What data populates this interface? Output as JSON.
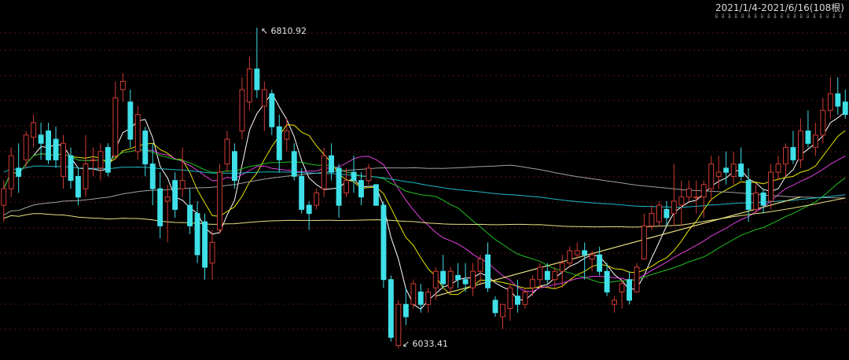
{
  "header": {
    "range_label": "2021/1/4-2021/6/16(108根)",
    "nav_arrows": "⇓⇓⇓⇓⇓⇓⇓⇓⇓⇓⇓⇓⇓⇓⇓⇓⇓⇓⇓⇓"
  },
  "annotations": {
    "high_label": "6810.92",
    "low_label": "6033.41"
  },
  "colors": {
    "background": "#000000",
    "up": "#d13b35",
    "down": "#3fe0e8",
    "grid": "#5a1414",
    "ma5": "#ffffff",
    "ma10": "#e6e600",
    "ma20": "#e040e0",
    "ma30": "#20c020",
    "ma60": "#a0a0a0",
    "ma120": "#20b8c8",
    "ma250": "#e8e080",
    "trendline": "#e8e080"
  },
  "chart_data": {
    "type": "candlestick",
    "title": "",
    "period_label": "2021/1/4-2021/6/16(108根)",
    "bar_count": 108,
    "high_annotation": 6810.92,
    "low_annotation": 6033.41,
    "ylim": [
      6030,
      6820
    ],
    "grid": true,
    "candles": [
      [
        6380,
        6440,
        6340,
        6420
      ],
      [
        6420,
        6520,
        6400,
        6500
      ],
      [
        6470,
        6530,
        6410,
        6450
      ],
      [
        6490,
        6560,
        6470,
        6550
      ],
      [
        6545,
        6600,
        6520,
        6580
      ],
      [
        6550,
        6580,
        6490,
        6530
      ],
      [
        6560,
        6580,
        6480,
        6490
      ],
      [
        6540,
        6570,
        6470,
        6490
      ],
      [
        6450,
        6550,
        6420,
        6530
      ],
      [
        6500,
        6520,
        6420,
        6440
      ],
      [
        6450,
        6470,
        6380,
        6400
      ],
      [
        6420,
        6550,
        6400,
        6480
      ],
      [
        6490,
        6520,
        6450,
        6490
      ],
      [
        6470,
        6530,
        6440,
        6510
      ],
      [
        6520,
        6530,
        6450,
        6460
      ],
      [
        6500,
        6680,
        6490,
        6640
      ],
      [
        6660,
        6700,
        6630,
        6680
      ],
      [
        6630,
        6660,
        6520,
        6540
      ],
      [
        6510,
        6620,
        6490,
        6600
      ],
      [
        6560,
        6570,
        6450,
        6480
      ],
      [
        6480,
        6530,
        6380,
        6420
      ],
      [
        6420,
        6460,
        6300,
        6330
      ],
      [
        6390,
        6430,
        6290,
        6400
      ],
      [
        6440,
        6460,
        6350,
        6370
      ],
      [
        6420,
        6520,
        6400,
        6440
      ],
      [
        6380,
        6420,
        6310,
        6330
      ],
      [
        6360,
        6390,
        6240,
        6260
      ],
      [
        6340,
        6360,
        6200,
        6230
      ],
      [
        6240,
        6320,
        6200,
        6290
      ],
      [
        6320,
        6480,
        6310,
        6460
      ],
      [
        6480,
        6560,
        6460,
        6540
      ],
      [
        6510,
        6530,
        6420,
        6440
      ],
      [
        6560,
        6690,
        6540,
        6660
      ],
      [
        6630,
        6740,
        6610,
        6710
      ],
      [
        6710,
        6810,
        6640,
        6660
      ],
      [
        6620,
        6680,
        6560,
        6660
      ],
      [
        6650,
        6660,
        6550,
        6570
      ],
      [
        6570,
        6600,
        6460,
        6490
      ],
      [
        6540,
        6590,
        6510,
        6560
      ],
      [
        6510,
        6530,
        6440,
        6450
      ],
      [
        6450,
        6470,
        6360,
        6370
      ],
      [
        6380,
        6390,
        6320,
        6360
      ],
      [
        6380,
        6420,
        6370,
        6410
      ],
      [
        6420,
        6520,
        6400,
        6500
      ],
      [
        6500,
        6530,
        6440,
        6460
      ],
      [
        6470,
        6480,
        6350,
        6380
      ],
      [
        6410,
        6470,
        6400,
        6440
      ],
      [
        6460,
        6500,
        6410,
        6440
      ],
      [
        6440,
        6460,
        6380,
        6400
      ],
      [
        6440,
        6480,
        6430,
        6470
      ],
      [
        6430,
        6430,
        6380,
        6380
      ],
      [
        6380,
        6390,
        6180,
        6200
      ],
      [
        6200,
        6210,
        6050,
        6060
      ],
      [
        6040,
        6150,
        6033,
        6140
      ],
      [
        6140,
        6180,
        6090,
        6110
      ],
      [
        6140,
        6200,
        6130,
        6190
      ],
      [
        6170,
        6190,
        6120,
        6140
      ],
      [
        6140,
        6180,
        6120,
        6170
      ],
      [
        6180,
        6230,
        6150,
        6220
      ],
      [
        6220,
        6260,
        6180,
        6190
      ],
      [
        6180,
        6230,
        6170,
        6220
      ],
      [
        6210,
        6240,
        6180,
        6200
      ],
      [
        6200,
        6240,
        6170,
        6190
      ],
      [
        6180,
        6240,
        6160,
        6220
      ],
      [
        6220,
        6260,
        6190,
        6250
      ],
      [
        6260,
        6290,
        6170,
        6180
      ],
      [
        6150,
        6160,
        6110,
        6120
      ],
      [
        6110,
        6140,
        6080,
        6140
      ],
      [
        6130,
        6190,
        6100,
        6180
      ],
      [
        6160,
        6200,
        6120,
        6140
      ],
      [
        6140,
        6180,
        6130,
        6170
      ],
      [
        6180,
        6210,
        6160,
        6200
      ],
      [
        6200,
        6240,
        6180,
        6230
      ],
      [
        6220,
        6240,
        6190,
        6200
      ],
      [
        6200,
        6230,
        6180,
        6220
      ],
      [
        6220,
        6260,
        6180,
        6240
      ],
      [
        6240,
        6280,
        6230,
        6270
      ],
      [
        6260,
        6290,
        6250,
        6270
      ],
      [
        6270,
        6290,
        6200,
        6260
      ],
      [
        6250,
        6270,
        6220,
        6260
      ],
      [
        6260,
        6280,
        6210,
        6220
      ],
      [
        6220,
        6240,
        6160,
        6170
      ],
      [
        6140,
        6160,
        6120,
        6150
      ],
      [
        6170,
        6200,
        6130,
        6190
      ],
      [
        6200,
        6220,
        6140,
        6150
      ],
      [
        6170,
        6240,
        6170,
        6230
      ],
      [
        6250,
        6360,
        6250,
        6330
      ],
      [
        6330,
        6380,
        6320,
        6360
      ],
      [
        6340,
        6390,
        6330,
        6380
      ],
      [
        6370,
        6390,
        6330,
        6350
      ],
      [
        6360,
        6480,
        6330,
        6390
      ],
      [
        6380,
        6440,
        6330,
        6400
      ],
      [
        6400,
        6440,
        6390,
        6420
      ],
      [
        6400,
        6440,
        6360,
        6400
      ],
      [
        6400,
        6440,
        6350,
        6430
      ],
      [
        6420,
        6500,
        6390,
        6480
      ],
      [
        6450,
        6500,
        6420,
        6460
      ],
      [
        6470,
        6510,
        6430,
        6460
      ],
      [
        6450,
        6510,
        6430,
        6480
      ],
      [
        6480,
        6520,
        6440,
        6450
      ],
      [
        6440,
        6470,
        6340,
        6370
      ],
      [
        6370,
        6430,
        6360,
        6410
      ],
      [
        6410,
        6420,
        6360,
        6380
      ],
      [
        6390,
        6480,
        6370,
        6460
      ],
      [
        6460,
        6500,
        6440,
        6480
      ],
      [
        6480,
        6530,
        6450,
        6520
      ],
      [
        6520,
        6560,
        6480,
        6490
      ],
      [
        6490,
        6590,
        6470,
        6560
      ],
      [
        6560,
        6610,
        6520,
        6530
      ],
      [
        6520,
        6580,
        6500,
        6550
      ],
      [
        6550,
        6640,
        6530,
        6610
      ],
      [
        6610,
        6690,
        6590,
        6650
      ],
      [
        6650,
        6690,
        6600,
        6620
      ],
      [
        6630,
        6660,
        6590,
        6600
      ]
    ],
    "ma_series": [
      {
        "key": "ma5",
        "period": 5
      },
      {
        "key": "ma10",
        "period": 10
      },
      {
        "key": "ma20",
        "period": 20
      },
      {
        "key": "ma30",
        "period": 30
      },
      {
        "key": "ma60",
        "period": 60
      },
      {
        "key": "ma120",
        "period": 120
      },
      {
        "key": "ma250",
        "period": 250
      }
    ],
    "ma_seed": {
      "ma60": [
        6340,
        6400,
        6460,
        6510,
        6470,
        6400
      ],
      "ma120": [
        6470,
        6460,
        6450,
        6420,
        6415,
        6410
      ],
      "ma250": [
        6330,
        6300,
        6310,
        6330,
        6360,
        6400
      ]
    },
    "trendline": {
      "from_bar": 58,
      "from_price": 6160,
      "to_bar": 107,
      "to_price": 6400
    }
  }
}
